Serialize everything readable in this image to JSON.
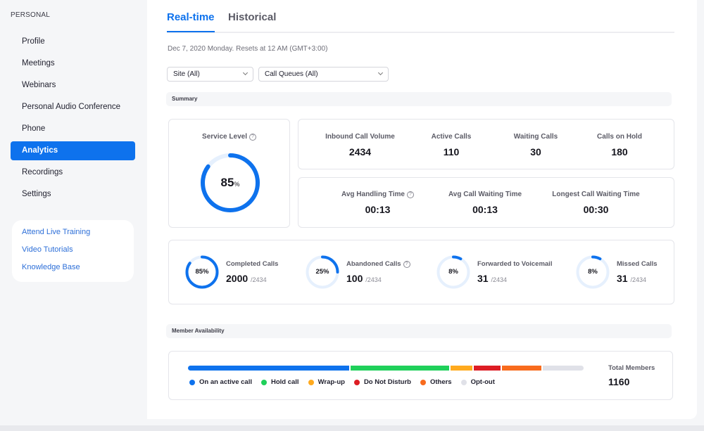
{
  "sidebar": {
    "section_label": "PERSONAL",
    "items": [
      {
        "label": "Profile",
        "active": false
      },
      {
        "label": "Meetings",
        "active": false
      },
      {
        "label": "Webinars",
        "active": false
      },
      {
        "label": "Personal Audio Conference",
        "active": false
      },
      {
        "label": "Phone",
        "active": false
      },
      {
        "label": "Analytics",
        "active": true
      },
      {
        "label": "Recordings",
        "active": false
      },
      {
        "label": "Settings",
        "active": false
      }
    ],
    "help_links": [
      "Attend Live Training",
      "Video Tutorials",
      "Knowledge Base"
    ]
  },
  "main": {
    "tabs": [
      {
        "label": "Real-time",
        "active": true
      },
      {
        "label": "Historical",
        "active": false
      }
    ],
    "date_line": "Dec 7, 2020 Monday. Resets at 12 AM (GMT+3:00)",
    "filters": {
      "site": {
        "selected": "Site (All)"
      },
      "call_queues": {
        "selected": "Call Queues (All)"
      }
    },
    "summary": {
      "section_label": "Summary",
      "service_level": {
        "label": "Service Level",
        "value": "85",
        "unit": "%",
        "fraction": 0.85,
        "help_icon": "question-circle-icon"
      },
      "volume_metrics": [
        {
          "label": "Inbound Call Volume",
          "value": "2434"
        },
        {
          "label": "Active Calls",
          "value": "110"
        },
        {
          "label": "Waiting Calls",
          "value": "30"
        },
        {
          "label": "Calls on Hold",
          "value": "180"
        }
      ],
      "time_metrics": [
        {
          "label": "Avg Handling Time",
          "value": "00:13",
          "help": true
        },
        {
          "label": "Avg Call Waiting Time",
          "value": "00:13",
          "help": false
        },
        {
          "label": "Longest Call Waiting Time",
          "value": "00:30",
          "help": false
        }
      ],
      "rates": [
        {
          "label": "Completed Calls",
          "pct_label": "85%",
          "fraction": 0.85,
          "value": "2000",
          "total": "/2434",
          "help": false
        },
        {
          "label": "Abandoned Calls",
          "pct_label": "25%",
          "fraction": 0.25,
          "value": "100",
          "total": "/2434",
          "help": true
        },
        {
          "label": "Forwarded to Voicemail",
          "pct_label": "8%",
          "fraction": 0.08,
          "value": "31",
          "total": "/2434",
          "help": false
        },
        {
          "label": "Missed Calls",
          "pct_label": "8%",
          "fraction": 0.08,
          "value": "31",
          "total": "/2434",
          "help": false
        }
      ]
    },
    "availability": {
      "section_label": "Member Availability",
      "segments": [
        {
          "label": "On an active call",
          "share": 0.41,
          "color": "#0e72ed"
        },
        {
          "label": "Hold call",
          "share": 0.25,
          "color": "#1fd05a"
        },
        {
          "label": "Wrap-up",
          "share": 0.055,
          "color": "#ffaa1e"
        },
        {
          "label": "Do Not Disturb",
          "share": 0.068,
          "color": "#dd1d24"
        },
        {
          "label": "Others",
          "share": 0.1,
          "color": "#f86b1d"
        },
        {
          "label": "Opt-out",
          "share": 0.105,
          "color": "#e0e1e8"
        }
      ],
      "total_label": "Total Members",
      "total_value": "1160"
    }
  },
  "colors": {
    "accent": "#0e72ed",
    "ring_track": "#e6f0fd"
  }
}
